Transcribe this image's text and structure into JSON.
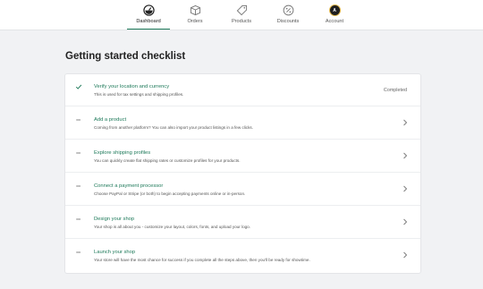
{
  "nav": {
    "items": [
      {
        "label": "Dashboard",
        "icon": "dashboard-icon",
        "active": true
      },
      {
        "label": "Orders",
        "icon": "box-icon",
        "active": false
      },
      {
        "label": "Products",
        "icon": "tag-icon",
        "active": false
      },
      {
        "label": "Discounts",
        "icon": "discount-icon",
        "active": false
      },
      {
        "label": "Account",
        "icon": "avatar",
        "active": false
      }
    ],
    "avatar_letter": "A"
  },
  "page": {
    "title": "Getting started checklist"
  },
  "checklist": [
    {
      "title": "Verify your location and currency",
      "desc": "This is used for tax settings and shipping profiles.",
      "status": "Completed",
      "done": true
    },
    {
      "title": "Add a product",
      "desc": "Coming from another platform? You can also import your product listings in a few clicks.",
      "status": "",
      "done": false
    },
    {
      "title": "Explore shipping profiles",
      "desc": "You can quickly create flat shipping rates or customize profiles for your products.",
      "status": "",
      "done": false
    },
    {
      "title": "Connect a payment processor",
      "desc": "Choose PayPal or Stripe (or both) to begin accepting payments online or in-person.",
      "status": "",
      "done": false
    },
    {
      "title": "Design your shop",
      "desc": "Your shop is all about you - customize your layout, colors, fonts, and upload your logo.",
      "status": "",
      "done": false
    },
    {
      "title": "Launch your shop",
      "desc": "Your store will have the most chance for success if you complete all the steps above, then you'll be ready for showtime.",
      "status": "",
      "done": false
    }
  ],
  "colors": {
    "accent": "#1e7a5a",
    "background": "#f1f2f4"
  }
}
